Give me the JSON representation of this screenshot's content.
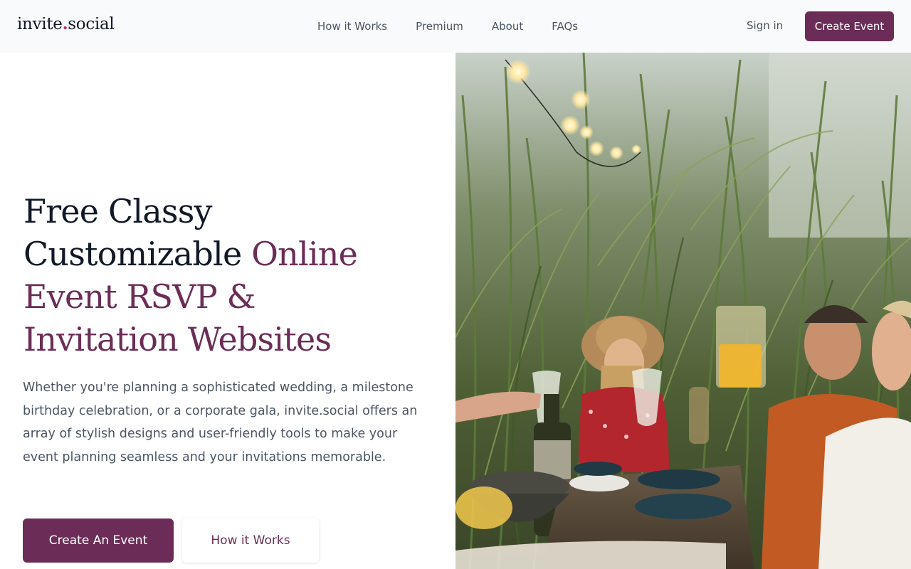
{
  "brand": {
    "name_part1": "invite",
    "dot": ".",
    "name_part2": "social",
    "accent_color": "#6b2d57"
  },
  "nav": {
    "items": [
      {
        "label": "How it Works"
      },
      {
        "label": "Premium"
      },
      {
        "label": "About"
      },
      {
        "label": "FAQs"
      }
    ],
    "sign_in_label": "Sign in",
    "create_event_label": "Create Event"
  },
  "hero": {
    "headline_line1": "Free Classy",
    "headline_line2_plain": "Customizable ",
    "headline_line2_accent": "Online",
    "headline_line3_accent": "Event RSVP &",
    "headline_line4_accent": "Invitation Websites",
    "description": "Whether you're planning a sophisticated wedding, a milestone birthday celebration, or a corporate gala, invite.social offers an array of stylish designs and user-friendly tools to make your event planning seamless and your invitations memorable.",
    "primary_cta_label": "Create An Event",
    "secondary_cta_label": "How it Works"
  },
  "colors": {
    "primary": "#6b2d57",
    "text_dark": "#111827",
    "text_muted": "#4b5563",
    "header_bg": "#f9fafb"
  }
}
